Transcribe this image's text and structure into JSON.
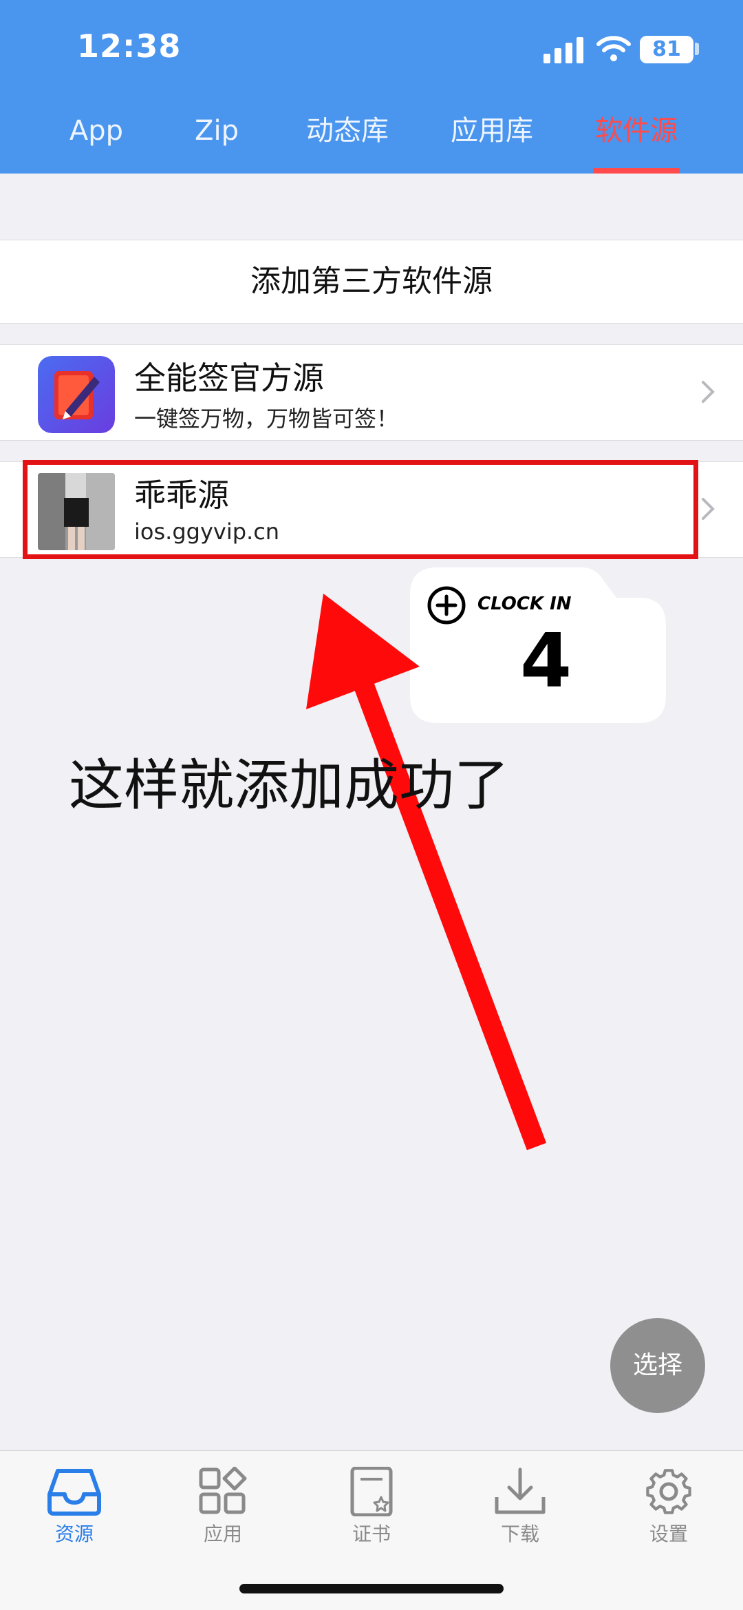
{
  "status_bar": {
    "time": "12:38",
    "battery": "81"
  },
  "top_tabs": [
    {
      "label": "App"
    },
    {
      "label": "Zip"
    },
    {
      "label": "动态库"
    },
    {
      "label": "应用库"
    },
    {
      "label": "软件源"
    }
  ],
  "add_source_label": "添加第三方软件源",
  "sources": [
    {
      "name": "全能签官方源",
      "subtitle": "一键签万物，万物皆可签！"
    },
    {
      "name": "乖乖源",
      "subtitle": "ios.ggyvip.cn"
    }
  ],
  "overlay": {
    "clock_label": "CLOCK IN",
    "clock_number": "4",
    "caption": "这样就添加成功了"
  },
  "fab_label": "选择",
  "bottom_tabs": [
    {
      "label": "资源"
    },
    {
      "label": "应用"
    },
    {
      "label": "证书"
    },
    {
      "label": "下载"
    },
    {
      "label": "设置"
    }
  ],
  "colors": {
    "header": "#4a95ee",
    "active_tab": "#ff4b4b",
    "highlight": "#e31214",
    "active_bottom": "#2a7ee8"
  }
}
